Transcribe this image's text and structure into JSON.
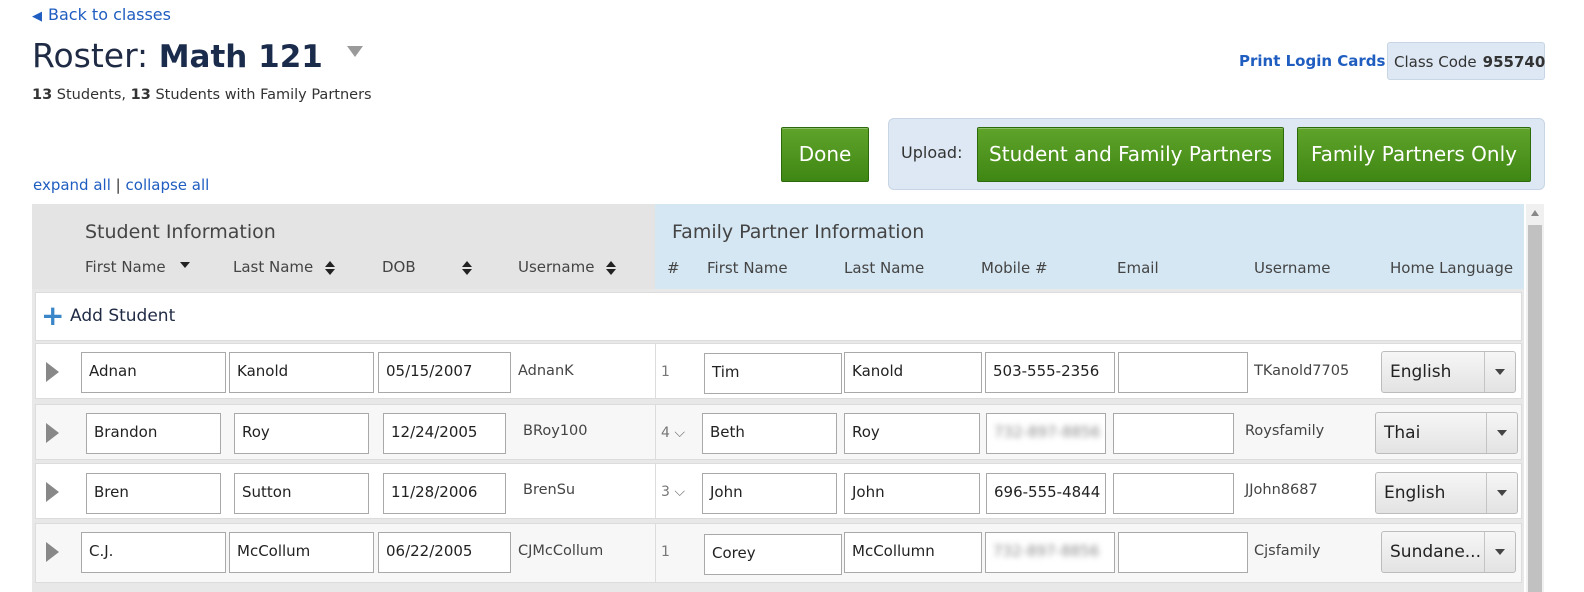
{
  "nav": {
    "back_label": "Back to classes"
  },
  "header": {
    "roster_prefix": "Roster:",
    "class_name": "Math 121",
    "students_count": "13",
    "students_label": "Students,",
    "partners_count": "13",
    "partners_label": "Students with Family Partners",
    "print_label": "Print Login Cards",
    "class_code_label": "Class Code",
    "class_code_value": "955740"
  },
  "actions": {
    "done_label": "Done",
    "upload_label": "Upload:",
    "upload_both_label": "Student and Family Partners",
    "upload_family_label": "Family Partners Only",
    "expand_all": "expand all",
    "separator": "|",
    "collapse_all": "collapse all"
  },
  "table": {
    "student_section": "Student Information",
    "family_section": "Family Partner Information",
    "student_columns": [
      "First Name",
      "Last Name",
      "DOB",
      "Username"
    ],
    "family_columns": [
      "#",
      "First Name",
      "Last Name",
      "Mobile #",
      "Email",
      "Username",
      "Home Language"
    ],
    "add_student_label": "Add Student",
    "rows": [
      {
        "first": "Adnan",
        "last": "Kanold",
        "dob": "05/15/2007",
        "username": "AdnanK",
        "num": "1",
        "fp_first": "Tim",
        "fp_last": "Kanold",
        "mobile": "503-555-2356",
        "email": "",
        "fp_username": "TKanold7705",
        "language": "English"
      },
      {
        "first": "Brandon",
        "last": "Roy",
        "dob": "12/24/2005",
        "username": "BRoy100",
        "num": "4",
        "fp_first": "Beth",
        "fp_last": "Roy",
        "mobile": "732-897-8856",
        "email": "",
        "fp_username": "Roysfamily",
        "language": "Thai"
      },
      {
        "first": "Bren",
        "last": "Sutton",
        "dob": "11/28/2006",
        "username": "BrenSu",
        "num": "3",
        "fp_first": "John",
        "fp_last": "John",
        "mobile": "696-555-4844",
        "email": "",
        "fp_username": "JJohn8687",
        "language": "English"
      },
      {
        "first": "C.J.",
        "last": "McCollum",
        "dob": "06/22/2005",
        "username": "CJMcCollum",
        "num": "1",
        "fp_first": "Corey",
        "fp_last": "McCollumn",
        "mobile": "732-897-8856",
        "email": "",
        "fp_username": "Cjsfamily",
        "language": "Sundane..."
      }
    ]
  }
}
